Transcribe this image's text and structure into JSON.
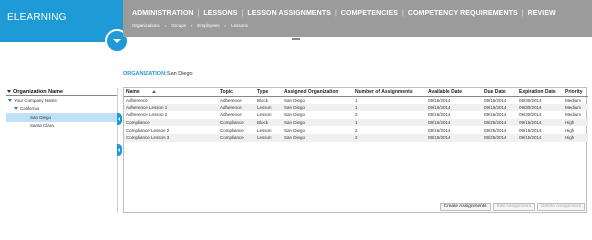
{
  "brand": {
    "title": "ELEARNING"
  },
  "nav": {
    "main": [
      "ADMINISTRATION",
      "LESSONS",
      "LESSON ASSIGNMENTS",
      "COMPETENCIES",
      "COMPETENCY REQUIREMENTS",
      "REVIEW"
    ],
    "active": "LESSON ASSIGNMENTS",
    "sub": [
      "Organizations",
      "Groups",
      "Employees",
      "Lessons"
    ]
  },
  "sidebar": {
    "header": "Organization Name",
    "tree": [
      {
        "label": "Your Company Name",
        "level": 1,
        "expanded": true
      },
      {
        "label": "California",
        "level": 2,
        "expanded": true
      },
      {
        "label": "San Diego",
        "level": 3,
        "selected": true
      },
      {
        "label": "Santa Clara",
        "level": 3
      }
    ]
  },
  "organization": {
    "label": "ORGANIZATION:",
    "value": "San Diego"
  },
  "table": {
    "columns": [
      "Name",
      "Topic",
      "Type",
      "Assigned Organization",
      "Number of Assignments",
      "Available Date",
      "Due Date",
      "Expiration Date",
      "Priority"
    ],
    "rows": [
      [
        "Adherence",
        "Adherence",
        "Block",
        "San Diego",
        "1",
        "09/16/2014",
        "09/15/2014",
        "09/30/2014",
        "Medium"
      ],
      [
        "Adherence Lesson 1",
        "Adherence",
        "Lesson",
        "San Diego",
        "1",
        "09/16/2014",
        "09/15/2014",
        "09/30/2014",
        "Medium"
      ],
      [
        "Adherence Lesson 2",
        "Adherence",
        "Lesson",
        "San Diego",
        "2",
        "09/16/2014",
        "09/15/2014",
        "09/30/2014",
        "Medium"
      ],
      [
        "Compliance",
        "Compliance",
        "Block",
        "San Diego",
        "1",
        "08/15/2014",
        "08/25/2014",
        "09/15/2014",
        "High"
      ],
      [
        "Compliance Lesson 2",
        "Compliance",
        "Lesson",
        "San Diego",
        "2",
        "08/15/2014",
        "08/25/2014",
        "09/15/2014",
        "High"
      ],
      [
        "Compliance Lesson 3",
        "Compliance",
        "Lesson",
        "San Diego",
        "2",
        "08/15/2014",
        "08/25/2014",
        "09/15/2014",
        "High"
      ]
    ]
  },
  "buttons": {
    "create": "Create Assignments",
    "edit": "Edit Assignment",
    "delete": "Delete Assignment"
  }
}
